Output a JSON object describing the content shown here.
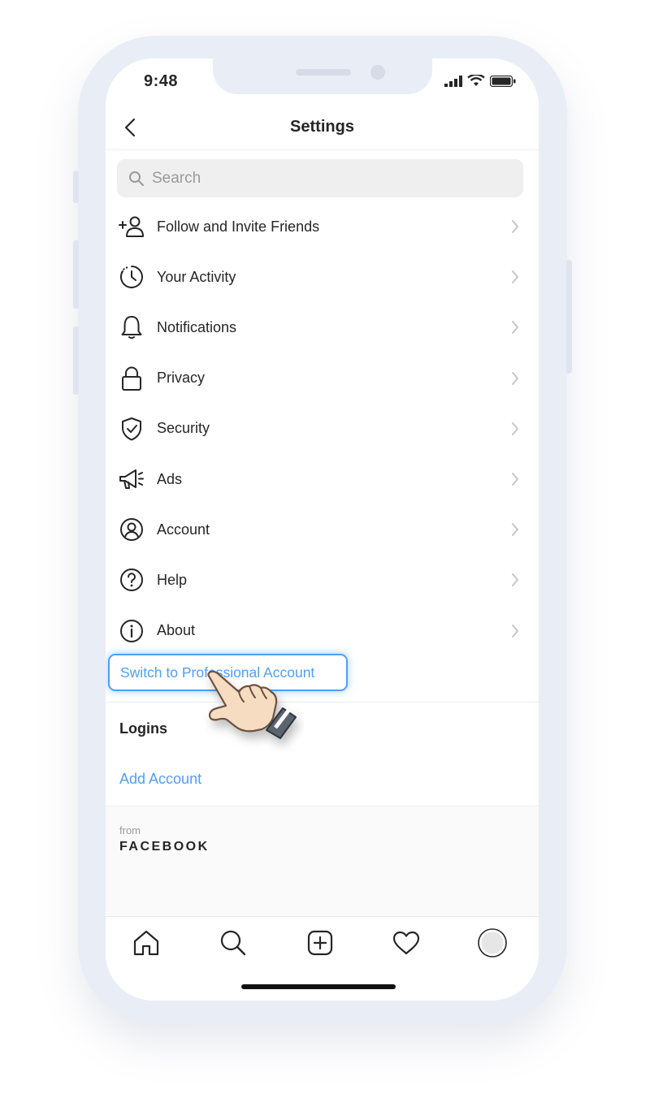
{
  "status_bar": {
    "time": "9:48"
  },
  "header": {
    "title": "Settings"
  },
  "search": {
    "placeholder": "Search"
  },
  "menu": {
    "items": [
      {
        "label": "Follow and Invite Friends",
        "icon": "add-person-icon"
      },
      {
        "label": "Your Activity",
        "icon": "activity-icon"
      },
      {
        "label": "Notifications",
        "icon": "bell-icon"
      },
      {
        "label": "Privacy",
        "icon": "lock-icon"
      },
      {
        "label": "Security",
        "icon": "shield-icon"
      },
      {
        "label": "Ads",
        "icon": "megaphone-icon"
      },
      {
        "label": "Account",
        "icon": "account-icon"
      },
      {
        "label": "Help",
        "icon": "help-icon"
      },
      {
        "label": "About",
        "icon": "info-icon"
      }
    ],
    "switch_professional": "Switch to Professional Account"
  },
  "logins": {
    "title": "Logins",
    "add_account": "Add Account"
  },
  "footer": {
    "from": "from",
    "brand": "FACEBOOK"
  },
  "tab_bar": {
    "tabs": [
      "home-icon",
      "search-icon",
      "create-icon",
      "heart-icon",
      "profile-avatar"
    ]
  },
  "colors": {
    "link_blue": "#4fa0f5",
    "text": "#262626",
    "frame": "#e9edf5"
  }
}
